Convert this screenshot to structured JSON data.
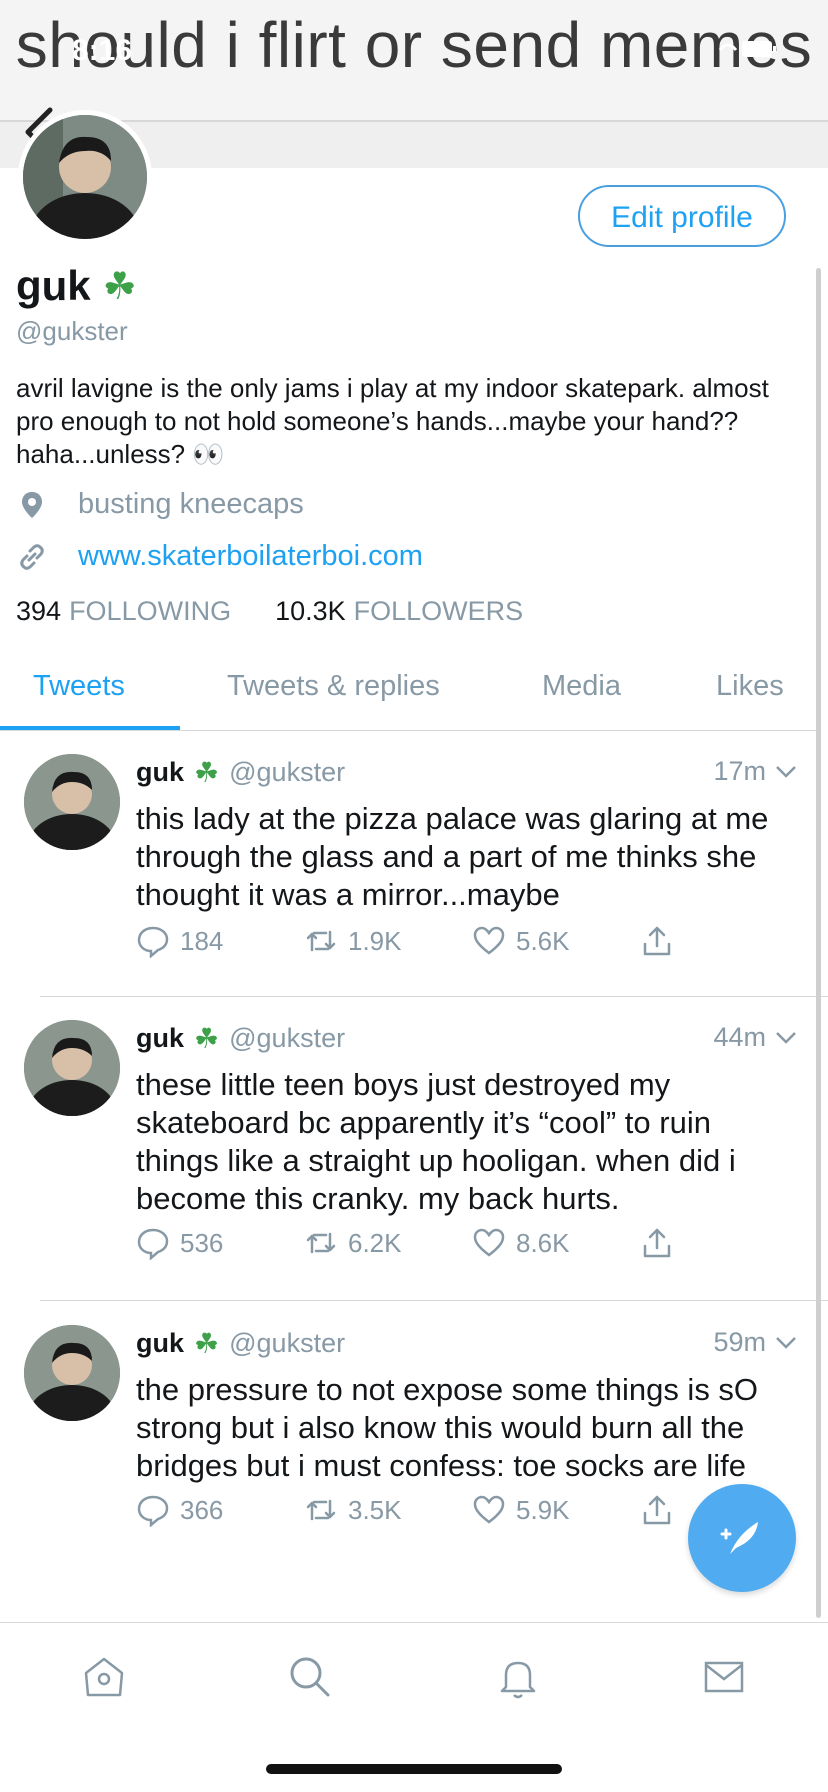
{
  "caption": "should i flirt or send memes",
  "status": {
    "time": "8:16"
  },
  "profile": {
    "edit_label": "Edit profile",
    "name": "guk",
    "name_emoji": "☘",
    "handle": "@gukster",
    "bio": "avril lavigne is the only jams i play at my indoor skatepark. almost pro enough to not hold someone’s hands...maybe your hand?? haha...unless? 👀",
    "location": "busting kneecaps",
    "website": "www.skaterboilaterboi.com",
    "following_count": "394",
    "following_label": "FOLLOWING",
    "followers_count": "10.3K",
    "followers_label": "FOLLOWERS"
  },
  "tabs": [
    "Tweets",
    "Tweets & replies",
    "Media",
    "Likes"
  ],
  "tweets": [
    {
      "name": "guk",
      "emoji": "☘",
      "handle": "@gukster",
      "time": "17m",
      "text": "this lady at the pizza palace was glaring at me through the glass and a part of me thinks she thought it was a mirror...maybe",
      "replies": "184",
      "retweets": "1.9K",
      "likes": "5.6K"
    },
    {
      "name": "guk",
      "emoji": "☘",
      "handle": "@gukster",
      "time": "44m",
      "text": "these little teen boys just destroyed my skateboard bc apparently it’s “cool” to ruin things like a straight up hooligan. when did i become this cranky. my back hurts.",
      "replies": "536",
      "retweets": "6.2K",
      "likes": "8.6K"
    },
    {
      "name": "guk",
      "emoji": "☘",
      "handle": "@gukster",
      "time": "59m",
      "text": "the pressure to not expose some things is sO strong but i also know this would burn all the bridges but i must confess: toe socks are life",
      "replies": "366",
      "retweets": "3.5K",
      "likes": "5.9K"
    }
  ],
  "colors": {
    "accent": "#1da1f2",
    "muted": "#8899a6",
    "text": "#14171a",
    "fab": "#50abf1"
  },
  "icons": [
    "back-chevron-icon",
    "location-pin-icon",
    "link-icon",
    "reply-icon",
    "retweet-icon",
    "like-icon",
    "share-icon",
    "compose-icon",
    "home-icon",
    "search-icon",
    "notifications-icon",
    "messages-icon"
  ]
}
